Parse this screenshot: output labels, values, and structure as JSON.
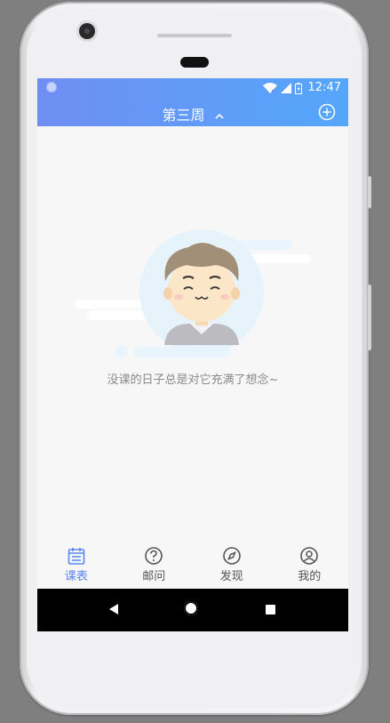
{
  "status_bar": {
    "time": "12:47",
    "icons": [
      "notification-dot-icon",
      "wifi-icon",
      "signal-icon",
      "battery-icon"
    ]
  },
  "header": {
    "title": "第三周",
    "title_dropdown_icon": "chevron-up-icon",
    "add_icon": "add-circle-icon"
  },
  "empty_state": {
    "message": "没课的日子总是对它充满了想念~",
    "illustration": "smiling-boy-illustration"
  },
  "bottom_nav": {
    "items": [
      {
        "label": "课表",
        "icon": "calendar-icon",
        "active": true
      },
      {
        "label": "邮问",
        "icon": "question-icon",
        "active": false
      },
      {
        "label": "发现",
        "icon": "compass-icon",
        "active": false
      },
      {
        "label": "我的",
        "icon": "user-icon",
        "active": false
      }
    ]
  },
  "system_nav": {
    "buttons": [
      "back-icon",
      "home-icon",
      "recents-icon"
    ]
  },
  "colors": {
    "header_gradient_start": "#6f8ef3",
    "header_gradient_end": "#54a7fb",
    "active_nav": "#5b86ef",
    "inactive_nav": "#555555"
  }
}
